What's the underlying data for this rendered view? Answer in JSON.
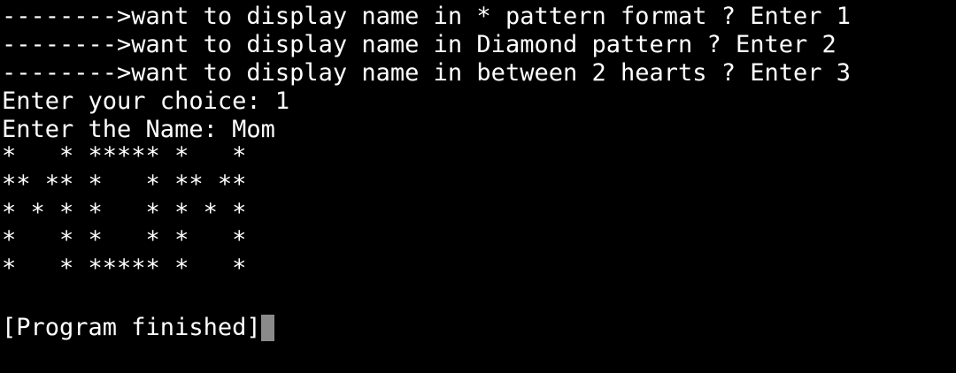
{
  "terminal": {
    "lines": [
      "-------->want to display name in * pattern format ? Enter 1",
      "-------->want to display name in Diamond pattern ? Enter 2",
      "-------->want to display name in between 2 hearts ? Enter 3",
      "Enter your choice: 1",
      "Enter the Name: Mom",
      "*   * ***** *   *",
      "** ** *   * ** **",
      "* * * *   * * * *",
      "*   * *   * *   *",
      "*   * ***** *   *",
      "[Program finished]"
    ],
    "colors": {
      "background": "#000000",
      "text": "#ffffff",
      "cursor": "#8a8a8a"
    }
  }
}
